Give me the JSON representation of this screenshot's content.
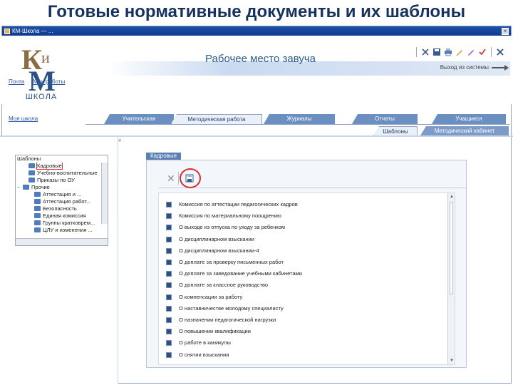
{
  "slide_title": "Готовые нормативные документы и их шаблоны",
  "window": {
    "title": "КМ-Школа — ...",
    "close_glyph": "×"
  },
  "logo": {
    "k": "К",
    "i": "и",
    "m": "М",
    "school": "ШКОЛА"
  },
  "header": {
    "page_title": "Рабочее место завуча",
    "logout_label": "Выход из системы"
  },
  "nav": {
    "links": [
      "Почта",
      "Мои работы"
    ],
    "school": "Моя школа"
  },
  "tabs": [
    {
      "label": "Учительская",
      "active": false
    },
    {
      "label": "Методическая работа",
      "active": true
    },
    {
      "label": "Журналы",
      "active": false
    },
    {
      "label": "Отчеты",
      "active": false
    },
    {
      "label": "Учащиеся",
      "active": false
    }
  ],
  "subtabs": [
    {
      "label": "Шаблоны",
      "active": true
    },
    {
      "label": "Методический кабинет",
      "active": false
    }
  ],
  "collapse_mark": "«",
  "tree": {
    "heading": "Шаблоны",
    "items": [
      {
        "label": "Кадровые",
        "selected": true,
        "indent": 1,
        "expander": ""
      },
      {
        "label": "Учебно-воспитательные",
        "selected": false,
        "indent": 1,
        "expander": ""
      },
      {
        "label": "Приказы по ОУ",
        "selected": false,
        "indent": 1,
        "expander": ""
      },
      {
        "label": "Прочие",
        "selected": false,
        "indent": 0,
        "expander": "−"
      },
      {
        "label": "Аттестация и ...",
        "selected": false,
        "indent": 2,
        "expander": ""
      },
      {
        "label": "Аттестация работ...",
        "selected": false,
        "indent": 2,
        "expander": ""
      },
      {
        "label": "Безопасность",
        "selected": false,
        "indent": 2,
        "expander": ""
      },
      {
        "label": "Единая комиссия",
        "selected": false,
        "indent": 2,
        "expander": ""
      },
      {
        "label": "Группы кратковрем...",
        "selected": false,
        "indent": 2,
        "expander": ""
      },
      {
        "label": "ЦЛУ и изменения ...",
        "selected": false,
        "indent": 2,
        "expander": ""
      }
    ]
  },
  "panel": {
    "tab_label": "Кадровые",
    "delete_glyph": "✕"
  },
  "documents": [
    "Комиссия по аттестации педагогических кадров",
    "Комиссия по материальному поощрению",
    "О выходе из отпуска по уходу за ребенком",
    "О дисциплинарном взыскании",
    "О дисциплинарном взыскании-4",
    "О доплате за проверку письменных работ",
    "О доплате за заведование учебными кабинетами",
    "О доплате за классное руководство",
    "О компенсации за работу",
    "О наставничестве молодому специалисту",
    "О назначении педагогической нагрузки",
    "О повышении квалификации",
    "О работе в каникулы",
    "О снятии взыскания"
  ],
  "scroll": {
    "up": "▲",
    "down": "▼"
  },
  "colors": {
    "title": "#16325e",
    "tab_bg": "#6b8fc0",
    "tab_active_bg": "#eaf0f8",
    "link": "#2a5ba4",
    "highlight": "#d92b2b"
  },
  "icons": {
    "toolbar": [
      "cut-icon",
      "save-icon",
      "print-icon",
      "pen-icon",
      "edit-icon",
      "check-icon",
      "close-icon"
    ],
    "tree": "folder-icon",
    "list": "document-icon"
  }
}
